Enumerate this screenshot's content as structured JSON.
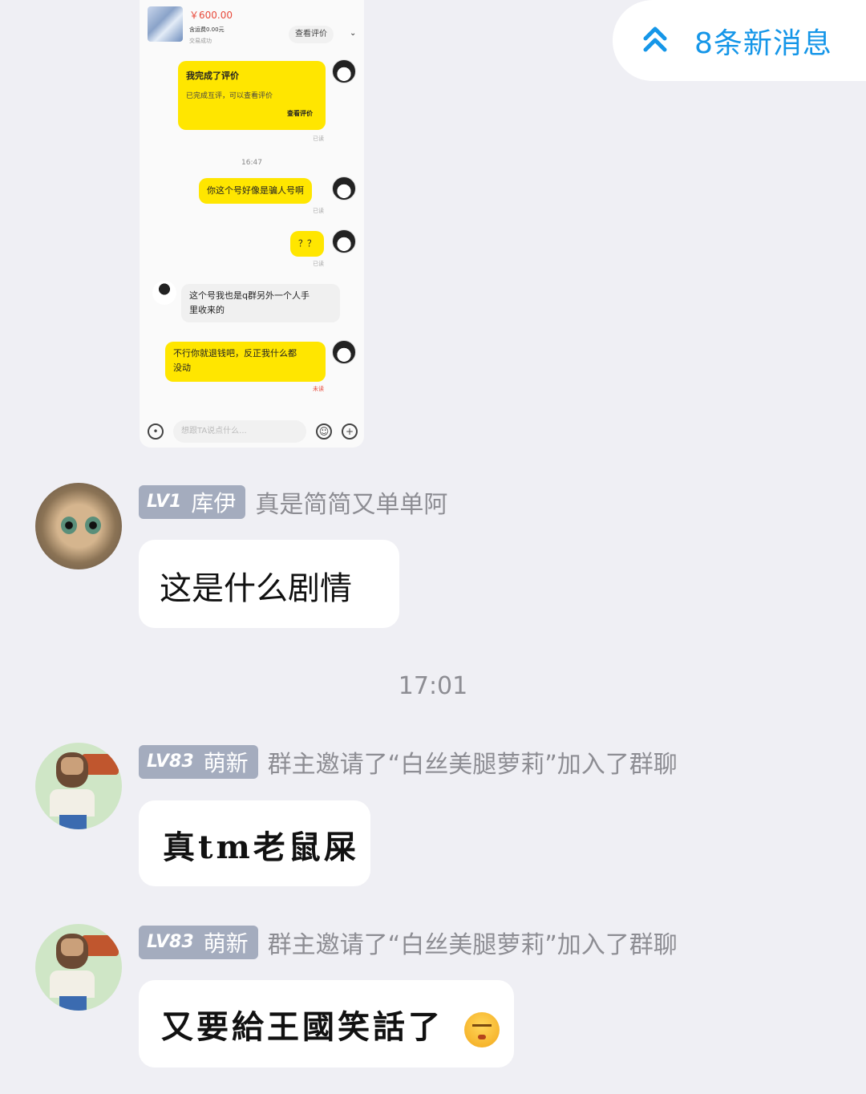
{
  "screenshot": {
    "order_price": "￥600.00",
    "order_fee": "含运费0.00元",
    "order_status": "交易成功",
    "review_button": "查看评价",
    "card_title": "我完成了评价",
    "card_sub": "已完成互评，可以查看评价",
    "card_button": "查看评价",
    "read": "已读",
    "unread": "未读",
    "time": "16:47",
    "msg1": "你这个号好像是骗人号啊",
    "msg2": "？？",
    "msg3_line1": "这个号我也是q群另外一个人手",
    "msg3_line2": "里收来的",
    "msg4_line1": "不行你就退钱吧，反正我什么都",
    "msg4_line2": "没动",
    "input_placeholder": "想跟TA说点什么..."
  },
  "new_messages": {
    "label": "8条新消息",
    "accent": "#1596e8"
  },
  "messages": [
    {
      "level": "LV1",
      "name": "库伊",
      "title": "真是简简又单单阿",
      "text": "这是什么剧情"
    },
    {
      "level": "LV83",
      "name": "萌新",
      "title": "群主邀请了“白丝美腿萝莉”加入了群聊",
      "text": "真tm老鼠屎"
    },
    {
      "level": "LV83",
      "name": "萌新",
      "title": "群主邀请了“白丝美腿萝莉”加入了群聊",
      "text": "又要給王國笑話了"
    }
  ],
  "timestamp": "17:01"
}
